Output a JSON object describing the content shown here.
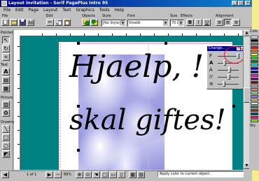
{
  "window": {
    "title": "Layout invitation - Serif PagePlus Intro 95",
    "controls": [
      "_",
      "□",
      "×"
    ]
  },
  "menu": [
    "File",
    "Edit",
    "Page",
    "Layout",
    "Text",
    "Graphics",
    "Tools",
    "Help"
  ],
  "toolbar_captions": {
    "file": "File",
    "edit": "Edit",
    "objects": "Objects",
    "style": "Style",
    "font": "Font",
    "size": "Size",
    "effects": "Effects",
    "alignment": "Alignment"
  },
  "toolbar": {
    "style_value": "[No Style]",
    "font_value": "Vivaldi",
    "size_value": "70.0pt",
    "bold": "B",
    "italic": "I",
    "underline": "U"
  },
  "toolbox": {
    "pointer_label": "Pointer",
    "text_label": "Text",
    "picture_label": "Picture",
    "drawing_label": "Drawing",
    "text_tool": "A"
  },
  "document": {
    "line1": "Hjaelp, !",
    "line2": "skal giftes!"
  },
  "floating_panel": {
    "title": "Change...",
    "rows": [
      {
        "icon": "F",
        "level": 0.95
      },
      {
        "icon": "A",
        "level": 0.3
      },
      {
        "icon": "A",
        "level": 0.55
      },
      {
        "icon": "///",
        "level": 0.5
      },
      {
        "icon": "≡",
        "level": 0.25
      }
    ]
  },
  "bottom": {
    "page_indicator": "1 of 1",
    "zoom": "89%",
    "status": "Apply color to current object."
  },
  "palette": {
    "title": "Colo",
    "styles_label": "Sty",
    "colors": [
      "#ffffff",
      "#000000",
      "#808080",
      "#ff0000",
      "#ff8000",
      "#ffff00",
      "#00ff00",
      "#008000",
      "#00ffff",
      "#0000ff",
      "#000080",
      "#ff00ff",
      "#800080",
      "#800000",
      "#c0c0c0",
      "#ff8080",
      "#80ff80",
      "#8080ff",
      "#ffc080",
      "#c0ffc0",
      "#408080",
      "#804000",
      "#004080",
      "#ff0080",
      "#80ff00"
    ]
  }
}
